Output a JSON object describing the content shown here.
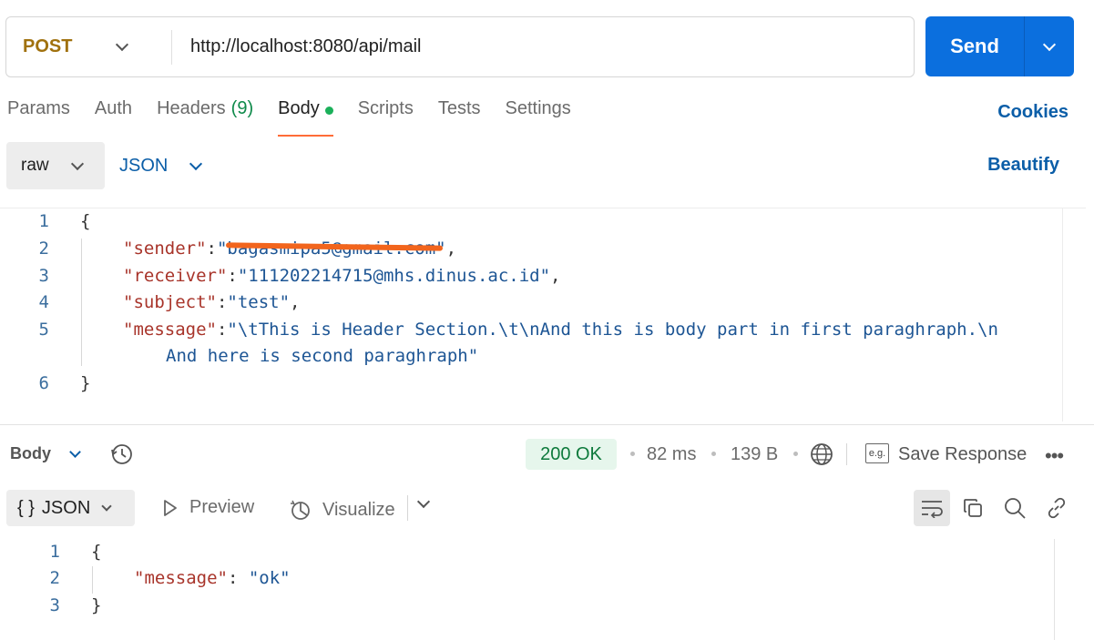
{
  "request": {
    "method": "POST",
    "url": "http://localhost:8080/api/mail",
    "send_label": "Send"
  },
  "tabs": [
    {
      "label": "Params"
    },
    {
      "label": "Auth"
    },
    {
      "label": "Headers",
      "count": "(9)"
    },
    {
      "label": "Body",
      "active": true
    },
    {
      "label": "Scripts"
    },
    {
      "label": "Tests"
    },
    {
      "label": "Settings"
    }
  ],
  "cookies_label": "Cookies",
  "body_mode": "raw",
  "body_format": "JSON",
  "beautify_label": "Beautify",
  "editor": {
    "line_numbers": [
      "1",
      "2",
      "3",
      "4",
      "5",
      "6"
    ],
    "open_brace": "{",
    "close_brace": "}",
    "lines": [
      {
        "key": "\"sender\"",
        "value": "\"bagasmipa5@gmail.com\"",
        "trail": ","
      },
      {
        "key": "\"receiver\"",
        "value": "\"111202214715@mhs.dinus.ac.id\"",
        "trail": ","
      },
      {
        "key": "\"subject\"",
        "value": "\"test\"",
        "trail": ","
      },
      {
        "key": "\"message\"",
        "value": "\"\\tThis is Header Section.\\t\\nAnd this is body part in first paraghraph.\\n",
        "wrap": "And here is second paraghraph\"",
        "trail": ""
      }
    ]
  },
  "response": {
    "body_label": "Body",
    "status": "200 OK",
    "time": "82 ms",
    "size": "139 B",
    "eg_label": "e.g.",
    "save_label": "Save Response",
    "more_label": "•••",
    "view_label": "JSON",
    "view_glyph": "{ }",
    "preview_label": "Preview",
    "visualize_label": "Visualize",
    "line_numbers": [
      "1",
      "2",
      "3"
    ],
    "open_brace": "{",
    "close_brace": "}",
    "key": "\"message\"",
    "colon": ": ",
    "value": "\"ok\""
  },
  "colors": {
    "accent": "#0b6fde",
    "method": "#a0710e",
    "tab_underline": "#ff6c37",
    "status_ok": "#0e7a3c",
    "json_key": "#a8342a",
    "json_string": "#1d5594",
    "redaction": "#f2651d"
  }
}
